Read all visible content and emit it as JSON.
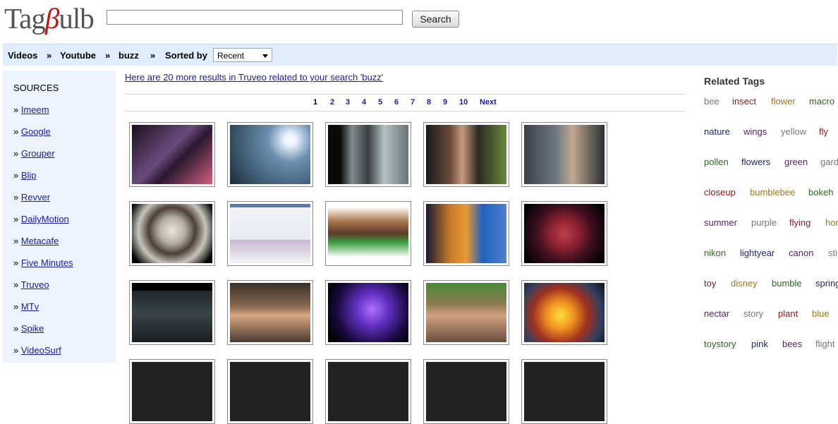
{
  "header": {
    "logo_part1": "Tag",
    "logo_part2": "β",
    "logo_part3": "ulb",
    "search_value": "",
    "search_button": "Search"
  },
  "breadcrumb": {
    "items": [
      "Videos",
      "Youtube",
      "buzz"
    ],
    "separator": "»",
    "sorted_label": "Sorted by",
    "sort_value": "Recent"
  },
  "sidebar": {
    "heading": "SOURCES",
    "bullet": "»",
    "items": [
      "Imeem",
      "Google",
      "Grouper",
      "Blip",
      "Revver",
      "DailyMotion",
      "Metacafe",
      "Five Minutes",
      "Truveo",
      "MTv",
      "Spike",
      "VideoSurf"
    ]
  },
  "main": {
    "results_text": "Here are 20 more results in Truveo related to your search 'buzz'",
    "pages": [
      "1",
      "2",
      "3",
      "4",
      "5",
      "6",
      "7",
      "8",
      "9",
      "10"
    ],
    "current_page": "1",
    "next_label": "Next",
    "thumbnails": [
      {
        "row": 0,
        "col": 0,
        "bg": "linear-gradient(135deg,#1c1020,#6a4a7a 45%,#2a1830 60%,#d06080)"
      },
      {
        "row": 0,
        "col": 1,
        "bg": "radial-gradient(circle at 75% 25%,#ffffff 0,#e8f2ff 8%,#6c8fae 30%,#3c5870 70%,#1e2c38)"
      },
      {
        "row": 0,
        "col": 2,
        "bg": "linear-gradient(90deg,#0a0a0a 15%,#7f8a8c 30%,#3a3f40 50%,#b5c2c4 70%,#6a7374)"
      },
      {
        "row": 0,
        "col": 3,
        "bg": "linear-gradient(90deg,#1a1a1a,#6a4a3a 30%,#c89a80 45%,#2a2a20 65%,#6a8a3a)"
      },
      {
        "row": 0,
        "col": 4,
        "bg": "linear-gradient(90deg,#3a4048,#6e7880 40%,#c0a890 60%,#2a2e34)"
      },
      {
        "row": 1,
        "col": 0,
        "bg": "radial-gradient(circle at 50% 45%,#e8e4de 0,#b8b0a4 25%,#4a4038 45%,#c8c4bc 65%,#000 90%)"
      },
      {
        "row": 1,
        "col": 1,
        "bg": "linear-gradient(180deg,#5a7aa8 0,#5a7aa8 6%,#f0f2f5 6%,#e6eaef 60%,#c8b8d0 61%,#f2f4f7)"
      },
      {
        "row": 1,
        "col": 2,
        "bg": "linear-gradient(180deg,#ffffff 5%,#a8744a 30%,#5a3a2a 50%,#3aa040 65%,#ffffff 90%)"
      },
      {
        "row": 1,
        "col": 3,
        "bg": "linear-gradient(90deg,#1a1a30,#c87a28 30%,#e89a38 50%,#2060c0 70%,#5080d0)"
      },
      {
        "row": 1,
        "col": 4,
        "bg": "radial-gradient(circle at 50% 50%,#c04050 0,#8a2030 30%,#401020 55%,#050205 90%)"
      },
      {
        "row": 2,
        "col": 0,
        "bg": "linear-gradient(180deg,#000 12%,#20282c 14%,#3a4448 50%,#1a1e20)"
      },
      {
        "row": 2,
        "col": 1,
        "bg": "linear-gradient(180deg,#3a3028,#8a6a50 40%,#d8a880 55%,#4a3a30)"
      },
      {
        "row": 2,
        "col": 2,
        "bg": "radial-gradient(circle at 55% 45%,#b070ff 0,#6030c0 30%,#1a0a40 65%,#000 90%)"
      },
      {
        "row": 2,
        "col": 3,
        "bg": "linear-gradient(180deg,#4a8a3a,#8a7a50 35%,#d0a080 55%,#6a5040)"
      },
      {
        "row": 2,
        "col": 4,
        "bg": "radial-gradient(circle at 45% 55%,#ffe040 0,#f09020 25%,#a03020 50%,#304060 75%,#101018)"
      }
    ]
  },
  "related": {
    "heading": "Related Tags",
    "tags": [
      {
        "text": "bee",
        "color": "#777777",
        "row": 0,
        "col": 0
      },
      {
        "text": "insect",
        "color": "#8b1a1a",
        "row": 0,
        "col": 1
      },
      {
        "text": "flower",
        "color": "#9a7a1a",
        "row": 0,
        "col": 2
      },
      {
        "text": "macro",
        "color": "#2a6a1a",
        "row": 0,
        "col": 3
      },
      {
        "text": "nature",
        "color": "#1a2a6a",
        "row": 1,
        "col": 0
      },
      {
        "text": "wings",
        "color": "#5a1a6a",
        "row": 1,
        "col": 1
      },
      {
        "text": "yellow",
        "color": "#777777",
        "row": 1,
        "col": 2
      },
      {
        "text": "fly",
        "color": "#8b1a1a",
        "row": 1,
        "col": 3
      },
      {
        "text": "pollen",
        "color": "#2a6a1a",
        "row": 2,
        "col": 0
      },
      {
        "text": "flowers",
        "color": "#1a2a6a",
        "row": 2,
        "col": 1
      },
      {
        "text": "green",
        "color": "#5a1a6a",
        "row": 2,
        "col": 2
      },
      {
        "text": "gard",
        "color": "#777777",
        "row": 2,
        "col": 3
      },
      {
        "text": "closeup",
        "color": "#8b1a1a",
        "row": 3,
        "col": 0
      },
      {
        "text": "bumblebee",
        "color": "#9a7a1a",
        "row": 3,
        "col": 1
      },
      {
        "text": "bokeh",
        "color": "#2a6a1a",
        "row": 3,
        "col": 2
      },
      {
        "text": "summer",
        "color": "#5a1a6a",
        "row": 4,
        "col": 0
      },
      {
        "text": "purple",
        "color": "#777777",
        "row": 4,
        "col": 1
      },
      {
        "text": "flying",
        "color": "#8b1a1a",
        "row": 4,
        "col": 2
      },
      {
        "text": "hor",
        "color": "#9a7a1a",
        "row": 4,
        "col": 3
      },
      {
        "text": "nikon",
        "color": "#2a6a1a",
        "row": 5,
        "col": 0
      },
      {
        "text": "lightyear",
        "color": "#1a2a6a",
        "row": 5,
        "col": 1
      },
      {
        "text": "canon",
        "color": "#5a1a6a",
        "row": 5,
        "col": 2
      },
      {
        "text": "sti",
        "color": "#777777",
        "row": 5,
        "col": 3
      },
      {
        "text": "toy",
        "color": "#8b1a1a",
        "row": 6,
        "col": 0
      },
      {
        "text": "disney",
        "color": "#9a7a1a",
        "row": 6,
        "col": 1
      },
      {
        "text": "bumble",
        "color": "#2a6a1a",
        "row": 6,
        "col": 2
      },
      {
        "text": "spring",
        "color": "#1a2a6a",
        "row": 6,
        "col": 3
      },
      {
        "text": "nectar",
        "color": "#5a1a6a",
        "row": 7,
        "col": 0
      },
      {
        "text": "story",
        "color": "#777777",
        "row": 7,
        "col": 1
      },
      {
        "text": "plant",
        "color": "#8b1a1a",
        "row": 7,
        "col": 2
      },
      {
        "text": "blue",
        "color": "#9a7a1a",
        "row": 7,
        "col": 3
      },
      {
        "text": "toystory",
        "color": "#2a6a1a",
        "row": 8,
        "col": 0
      },
      {
        "text": "pink",
        "color": "#1a2a6a",
        "row": 8,
        "col": 1
      },
      {
        "text": "bees",
        "color": "#5a1a6a",
        "row": 8,
        "col": 2
      },
      {
        "text": "flight",
        "color": "#777777",
        "row": 8,
        "col": 3
      }
    ]
  }
}
